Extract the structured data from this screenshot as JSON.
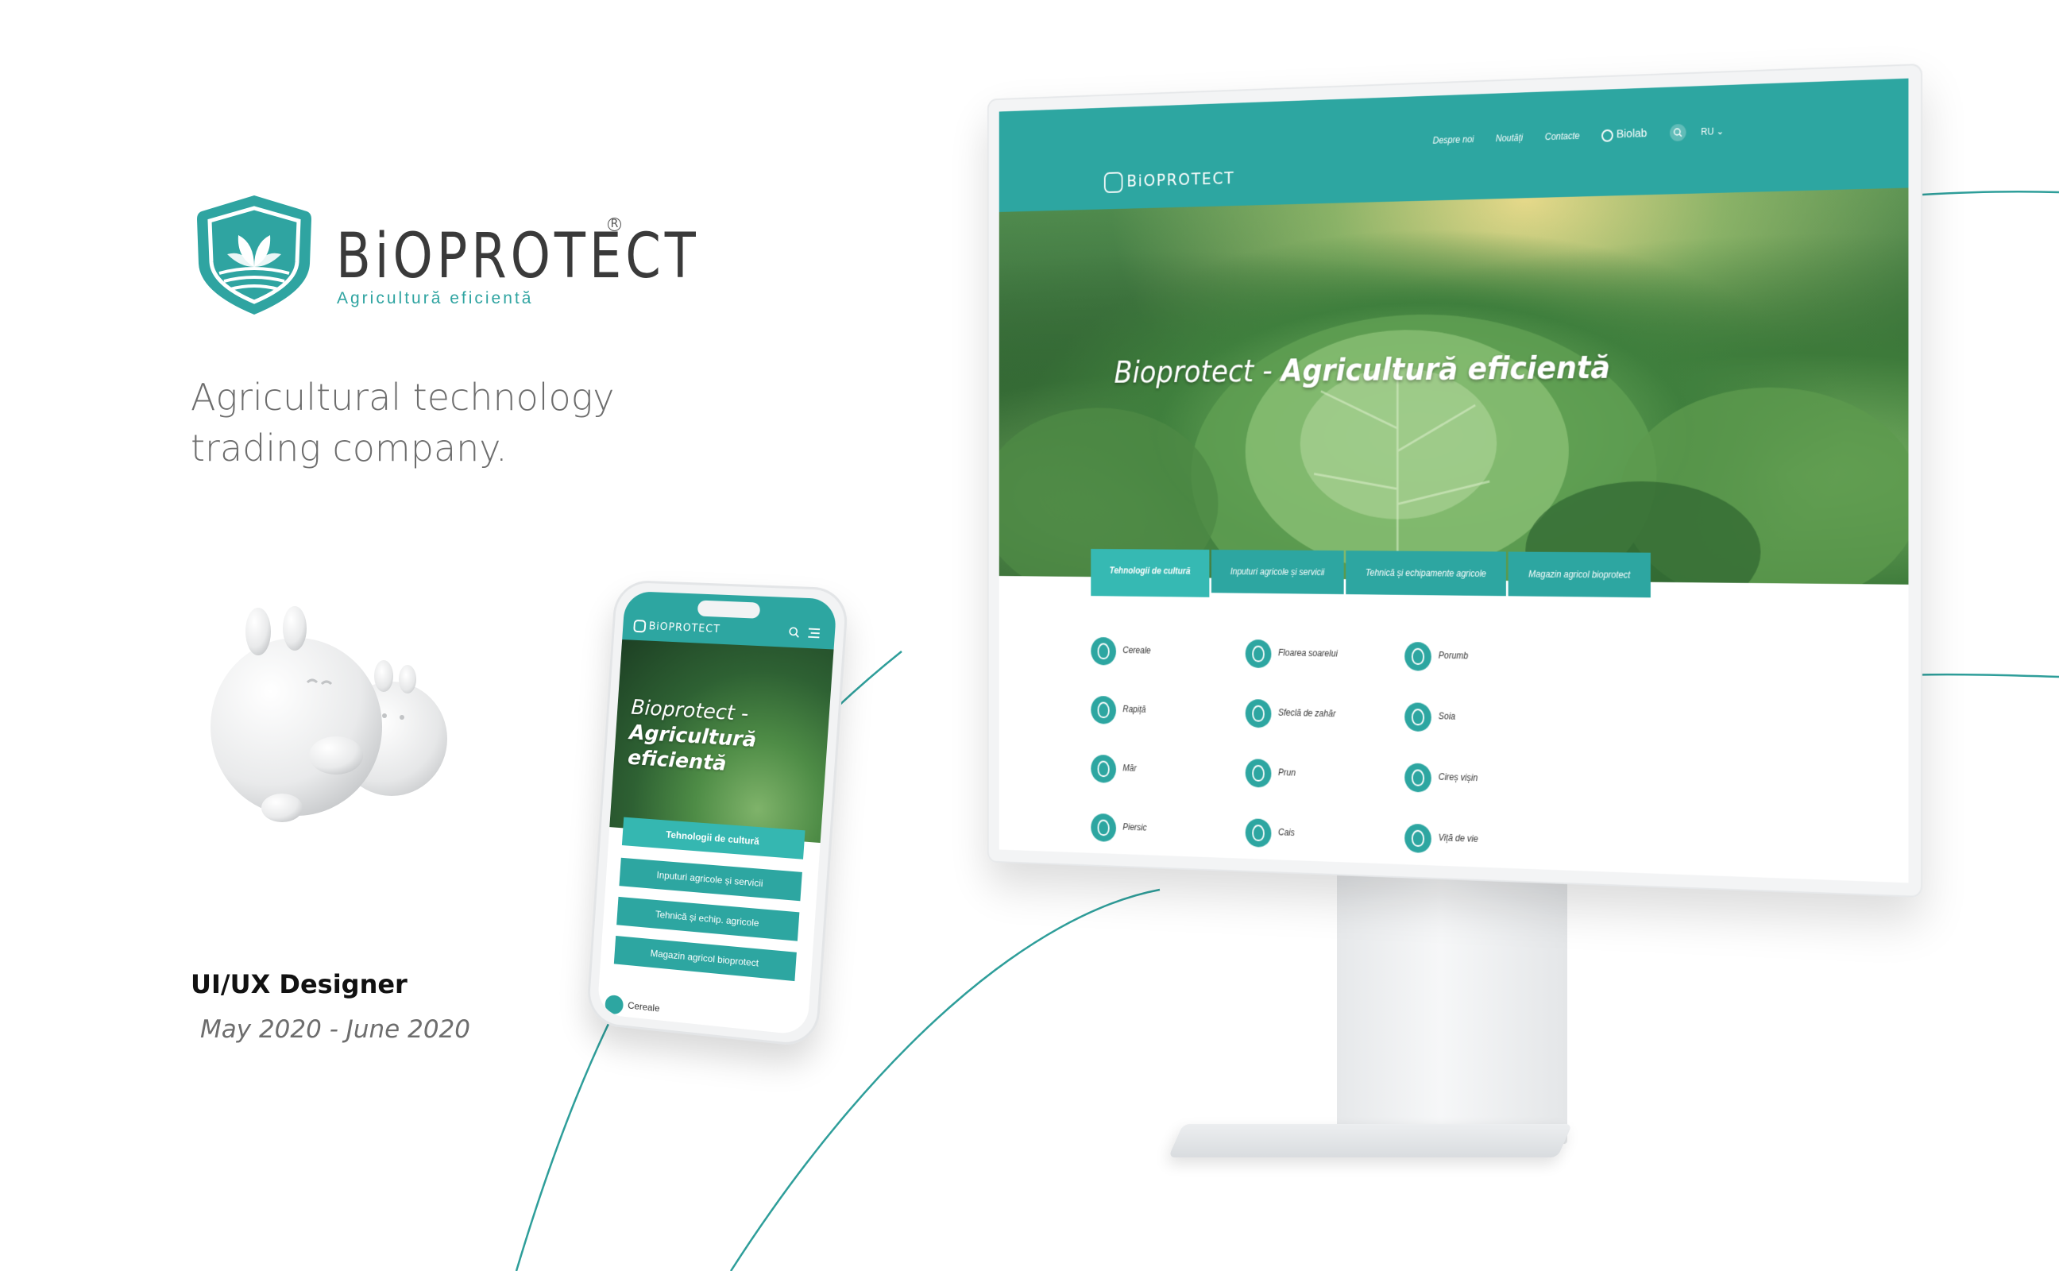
{
  "brand": {
    "wordmark": "BiOPROTECT",
    "registered": "R",
    "tagline": "Agricultură eficientă",
    "accent_color": "#2da6a1"
  },
  "headline": {
    "line1": "Agricultural technology",
    "line2": "trading company."
  },
  "role": {
    "title": "UI/UX Designer",
    "dates": "May 2020 - June 2020"
  },
  "mascot": {
    "icon": "bunny-mascot-3d"
  },
  "mobile": {
    "logo": "BiOPROTECT",
    "hero_title_light": "Bioprotect -",
    "hero_title_bold_1": "Agricultură",
    "hero_title_bold_2": "eficientă",
    "buttons": [
      "Tehnologii de cultură",
      "Inputuri agricole și servicii",
      "Tehnică și echip. agricole",
      "Magazin agricol bioprotect"
    ],
    "first_category": "Cereale"
  },
  "desktop": {
    "logo": "BiOPROTECT",
    "menu": [
      "Despre noi",
      "Noutăți",
      "Contacte"
    ],
    "partner": "Biolab",
    "language": "RU",
    "hero_title_light": "Bioprotect - ",
    "hero_title_bold": "Agricultură eficientă",
    "tabs": [
      "Tehnologii de cultură",
      "Inputuri agricole și servicii",
      "Tehnică și echipamente agricole",
      "Magazin agricol bioprotect"
    ],
    "categories": [
      "Cereale",
      "Floarea soarelui",
      "Porumb",
      "Rapiță",
      "Sfeclă de zahăr",
      "Soia",
      "Măr",
      "Prun",
      "Cireș vișin",
      "Piersic",
      "Cais",
      "Viță de vie"
    ]
  }
}
